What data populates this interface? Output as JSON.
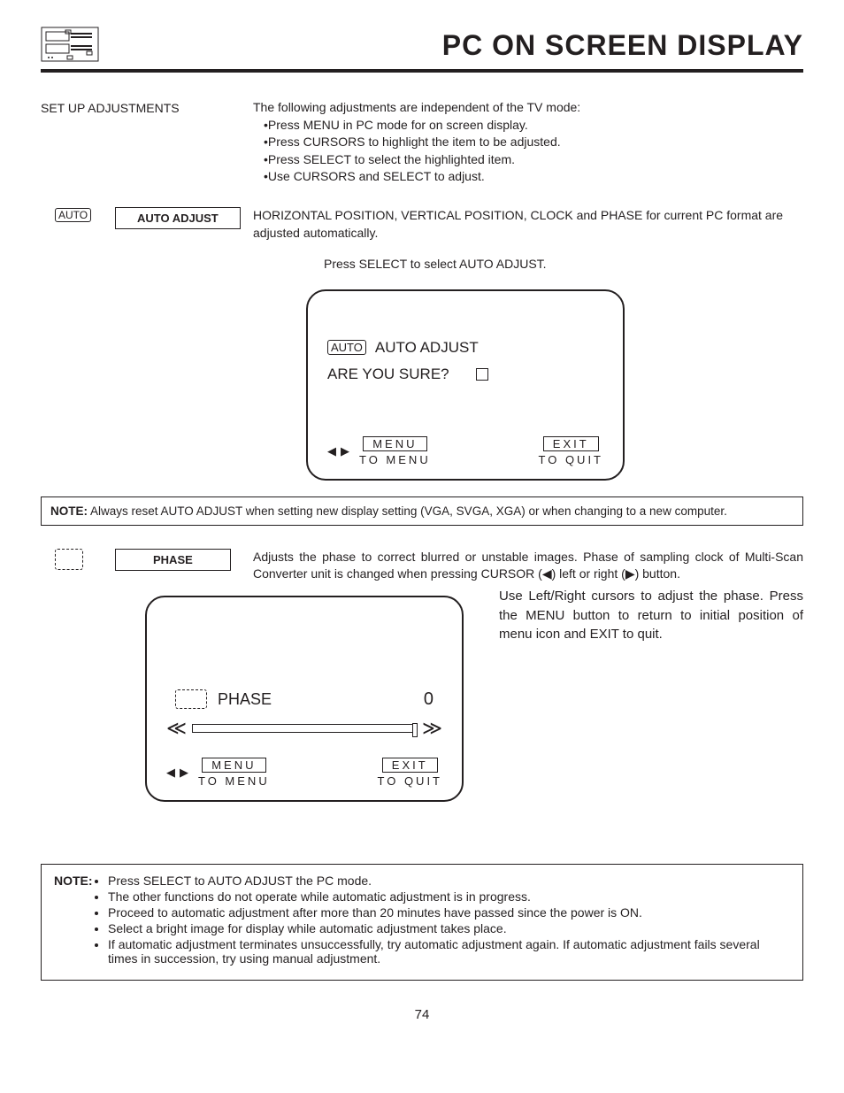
{
  "title": "PC ON SCREEN DISPLAY",
  "setup": {
    "heading": "SET UP ADJUSTMENTS",
    "intro": "The following adjustments are independent of the TV mode:",
    "b1": "•Press MENU in PC mode for on screen display.",
    "b2": "•Press CURSORS to highlight the item to be adjusted.",
    "b3": "•Press SELECT to select the highlighted item.",
    "b4": "•Use CURSORS and SELECT to adjust."
  },
  "auto": {
    "chip": "AUTO",
    "btn": "AUTO ADJUST",
    "desc": "HORIZONTAL POSITION, VERTICAL POSITION, CLOCK and PHASE for current PC format are adjusted automatically.",
    "press": "Press SELECT to select AUTO ADJUST.",
    "osd_title": "AUTO ADJUST",
    "confirm": "ARE YOU SURE?",
    "menu": "MENU",
    "tomenu": "TO MENU",
    "exit": "EXIT",
    "toquit": "TO QUIT"
  },
  "note1": {
    "tag": "NOTE:",
    "text": " Always reset AUTO ADJUST when setting new display setting (VGA, SVGA, XGA) or when changing to a new computer."
  },
  "phase": {
    "btn": "PHASE",
    "desc": "Adjusts the phase to correct blurred or unstable images.  Phase of sampling clock of Multi-Scan Converter unit is changed when pressing CURSOR (◀) left or right (▶) button.",
    "rhs": "Use Left/Right cursors to adjust the phase.  Press the MENU button to return to initial position of menu icon and EXIT to quit.",
    "osd_label": "PHASE",
    "value": "0",
    "menu": "MENU",
    "tomenu": "TO MENU",
    "exit": "EXIT",
    "toquit": "TO QUIT"
  },
  "note2": {
    "tag": "NOTE:",
    "i1": "Press SELECT to AUTO ADJUST the PC mode.",
    "i2": "The other functions do not operate while automatic adjustment is in progress.",
    "i3": "Proceed to automatic adjustment after more than 20 minutes have passed since the power is ON.",
    "i4": "Select a bright image for display while automatic adjustment takes place.",
    "i5": "If automatic adjustment terminates unsuccessfully, try automatic adjustment again.  If automatic adjustment fails several times in succession, try using manual adjustment."
  },
  "pgnum": "74"
}
